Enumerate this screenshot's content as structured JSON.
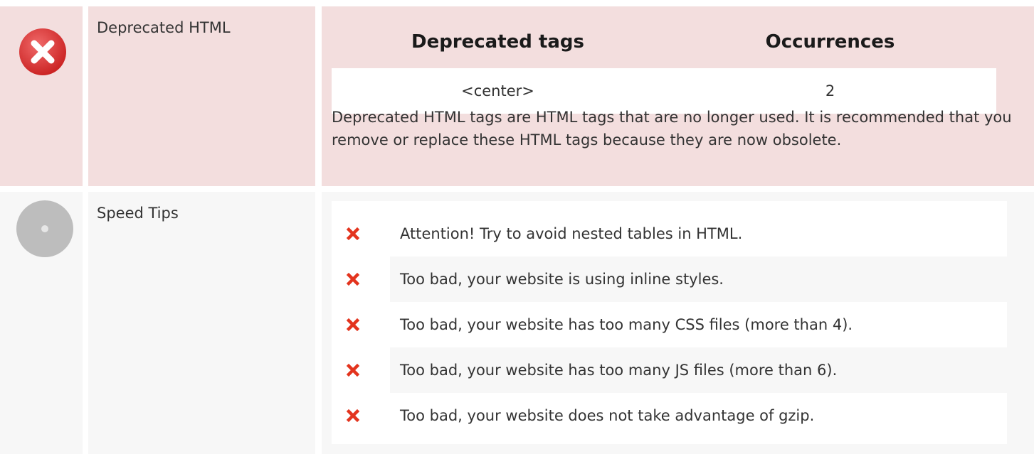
{
  "colors": {
    "error_row_bg": "#f3dede",
    "neutral_row_bg": "#f7f7f7",
    "error_icon": "#e23b3b",
    "x_mark": "#e3341e",
    "disc_icon": "#bdbdbd"
  },
  "deprecated": {
    "icon": "error-circle-icon",
    "label": "Deprecated HTML",
    "table": {
      "headers": [
        "Deprecated tags",
        "Occurrences"
      ],
      "rows": [
        {
          "tag": "<center>",
          "count": "2"
        }
      ]
    },
    "description": "Deprecated HTML tags are HTML tags that are no longer used. It is recommended that you remove or replace these HTML tags because they are now obsolete."
  },
  "speed_tips": {
    "icon": "neutral-disc-icon",
    "label": "Speed Tips",
    "items": [
      {
        "icon": "x-mark-icon",
        "text": "Attention! Try to avoid nested tables in HTML."
      },
      {
        "icon": "x-mark-icon",
        "text": "Too bad, your website is using inline styles."
      },
      {
        "icon": "x-mark-icon",
        "text": "Too bad, your website has too many CSS files (more than 4)."
      },
      {
        "icon": "x-mark-icon",
        "text": "Too bad, your website has too many JS files (more than 6)."
      },
      {
        "icon": "x-mark-icon",
        "text": "Too bad, your website does not take advantage of gzip."
      }
    ]
  }
}
